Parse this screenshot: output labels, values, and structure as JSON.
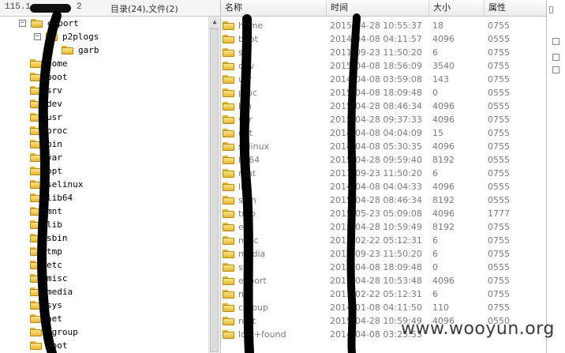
{
  "left_panel": {
    "host": "115.1",
    "host_suffix": "2",
    "dir_summary": "目录(24),文件(2)",
    "tree": [
      {
        "name": "export",
        "expander": "−",
        "depth": 0
      },
      {
        "name": "p2plogs",
        "expander": "−",
        "depth": 1
      },
      {
        "name": "garb",
        "expander": "",
        "depth": 2
      },
      {
        "name": "home",
        "expander": "",
        "depth": 0
      },
      {
        "name": "boot",
        "expander": "",
        "depth": 0
      },
      {
        "name": "srv",
        "expander": "",
        "depth": 0
      },
      {
        "name": "dev",
        "expander": "",
        "depth": 0
      },
      {
        "name": "usr",
        "expander": "",
        "depth": 0
      },
      {
        "name": "proc",
        "expander": "",
        "depth": 0
      },
      {
        "name": "bin",
        "expander": "",
        "depth": 0
      },
      {
        "name": "var",
        "expander": "",
        "depth": 0
      },
      {
        "name": "opt",
        "expander": "",
        "depth": 0
      },
      {
        "name": "selinux",
        "expander": "",
        "depth": 0
      },
      {
        "name": "lib64",
        "expander": "",
        "depth": 0
      },
      {
        "name": "mnt",
        "expander": "",
        "depth": 0
      },
      {
        "name": "lib",
        "expander": "",
        "depth": 0
      },
      {
        "name": "sbin",
        "expander": "",
        "depth": 0
      },
      {
        "name": "tmp",
        "expander": "",
        "depth": 0
      },
      {
        "name": "etc",
        "expander": "",
        "depth": 0
      },
      {
        "name": "misc",
        "expander": "",
        "depth": 0
      },
      {
        "name": "media",
        "expander": "",
        "depth": 0
      },
      {
        "name": "sys",
        "expander": "",
        "depth": 0
      },
      {
        "name": "net",
        "expander": "",
        "depth": 0
      },
      {
        "name": "cgroup",
        "expander": "",
        "depth": 0
      },
      {
        "name": "root",
        "expander": "",
        "depth": 0
      }
    ]
  },
  "file_list": {
    "columns": {
      "name": "名称",
      "time": "时间",
      "size": "大小",
      "attr": "属性"
    },
    "rows": [
      {
        "name": "home",
        "time": "2015-04-28 10:55:37",
        "size": "18",
        "attr": "0755"
      },
      {
        "name": "boot",
        "time": "2014-04-08 04:11:57",
        "size": "4096",
        "attr": "0555"
      },
      {
        "name": "srv",
        "time": "2011-09-23 11:50:20",
        "size": "6",
        "attr": "0755"
      },
      {
        "name": "dev",
        "time": "2015-04-08 18:56:09",
        "size": "3540",
        "attr": "0755"
      },
      {
        "name": "usr",
        "time": "2014-04-08 03:59:08",
        "size": "143",
        "attr": "0755"
      },
      {
        "name": "proc",
        "time": "2015-04-08 18:09:48",
        "size": "0",
        "attr": "0555"
      },
      {
        "name": "bin",
        "time": "2015-04-28 08:46:34",
        "size": "4096",
        "attr": "0555"
      },
      {
        "name": "var",
        "time": "2015-04-28 09:37:33",
        "size": "4096",
        "attr": "0755"
      },
      {
        "name": "opt",
        "time": "2014-04-08 04:04:09",
        "size": "15",
        "attr": "0755"
      },
      {
        "name": "selinux",
        "time": "2014-04-08 05:30:35",
        "size": "4096",
        "attr": "0755"
      },
      {
        "name": "lib64",
        "time": "2015-04-28 09:59:40",
        "size": "8192",
        "attr": "0555"
      },
      {
        "name": "mnt",
        "time": "2011-09-23 11:50:20",
        "size": "6",
        "attr": "0755"
      },
      {
        "name": "lib",
        "time": "2014-04-08 04:04:33",
        "size": "4096",
        "attr": "0555"
      },
      {
        "name": "sbin",
        "time": "2015-04-28 08:46:34",
        "size": "8192",
        "attr": "0555"
      },
      {
        "name": "tmp",
        "time": "2015-05-23 05:09:08",
        "size": "4096",
        "attr": "1777"
      },
      {
        "name": "etc",
        "time": "2015-04-28 10:59:49",
        "size": "8192",
        "attr": "0755"
      },
      {
        "name": "misc",
        "time": "2013-02-22 05:12:31",
        "size": "6",
        "attr": "0755"
      },
      {
        "name": "media",
        "time": "2011-09-23 11:50:20",
        "size": "6",
        "attr": "0755"
      },
      {
        "name": "sys",
        "time": "2015-04-08 18:09:48",
        "size": "0",
        "attr": "0555"
      },
      {
        "name": "export",
        "time": "2015-04-28 10:53:48",
        "size": "4096",
        "attr": "0755"
      },
      {
        "name": "net",
        "time": "2013-02-22 05:12:31",
        "size": "6",
        "attr": "0755"
      },
      {
        "name": "cgroup",
        "time": "2014-01-08 04:11:50",
        "size": "110",
        "attr": "0755"
      },
      {
        "name": "root",
        "time": "2015-04-28 10:59:49",
        "size": "4096",
        "attr": "0550"
      },
      {
        "name": "lost+found",
        "time": "2014-04-08 03:25:53",
        "size": "",
        "attr": ""
      }
    ]
  },
  "watermark": "www.wooyun.org",
  "colors": {
    "folder_fill": "#f3cd5a",
    "folder_border": "#b88917",
    "redaction": "#000000",
    "list_text": "#7b7b7b"
  }
}
